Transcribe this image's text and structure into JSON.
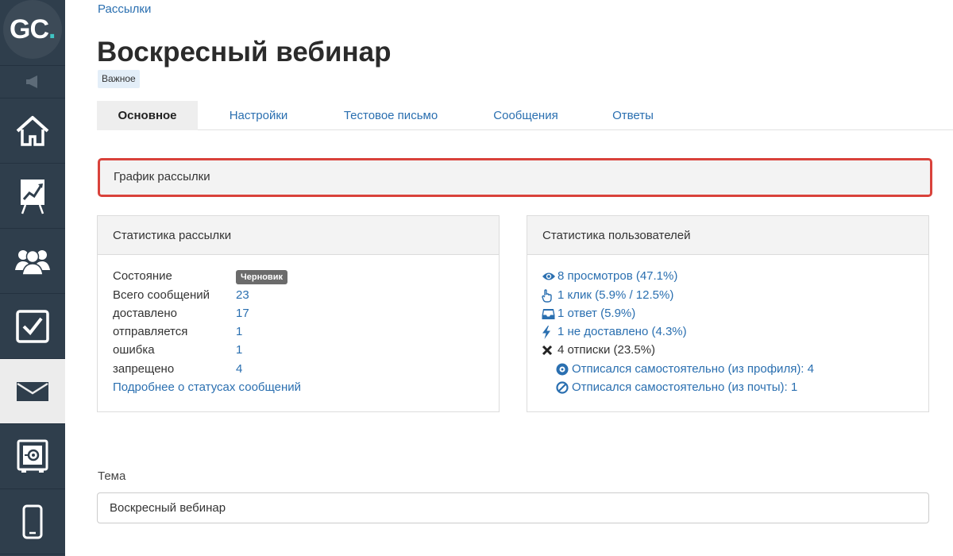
{
  "logo": {
    "text_main": "GC",
    "text_accent": "."
  },
  "breadcrumb": "Рассылки",
  "page_title": "Воскресный вебинар",
  "tag": "Важное",
  "tabs": [
    {
      "label": "Основное",
      "active": true
    },
    {
      "label": "Настройки",
      "active": false
    },
    {
      "label": "Тестовое письмо",
      "active": false
    },
    {
      "label": "Сообщения",
      "active": false
    },
    {
      "label": "Ответы",
      "active": false
    }
  ],
  "schedule": {
    "title": "График рассылки"
  },
  "mailing_stats": {
    "title": "Статистика рассылки",
    "state_label": "Состояние",
    "state_badge": "Черновик",
    "rows": [
      {
        "label": "Всего сообщений",
        "value": "23"
      },
      {
        "label": "доставлено",
        "value": "17"
      },
      {
        "label": "отправляется",
        "value": "1"
      },
      {
        "label": "ошибка",
        "value": "1"
      },
      {
        "label": "запрещено",
        "value": "4"
      }
    ],
    "details_link": "Подробнее о статусах сообщений"
  },
  "user_stats": {
    "title": "Статистика пользователей",
    "views": "8 просмотров (47.1%)",
    "clicks": "1 клик (5.9% / 12.5%)",
    "replies": "1 ответ (5.9%)",
    "not_delivered": "1 не доставлено (4.3%)",
    "unsubscribes": "4 отписки (23.5%)",
    "unsub_profile": "Отписался самостоятельно (из профиля): 4",
    "unsub_mail": "Отписался самостоятельно (из почты): 1"
  },
  "topic": {
    "label": "Тема",
    "value": "Воскресный вебинар"
  },
  "colors": {
    "sidebar": "#2f3e4c",
    "link": "#2a6fb0",
    "highlight_border": "#d9423b",
    "logo_accent": "#3fc4c4"
  },
  "sidebar_icons": [
    "megaphone-icon",
    "home-icon",
    "chart-icon",
    "users-icon",
    "tasks-icon",
    "mail-icon",
    "safe-icon",
    "mobile-icon"
  ]
}
